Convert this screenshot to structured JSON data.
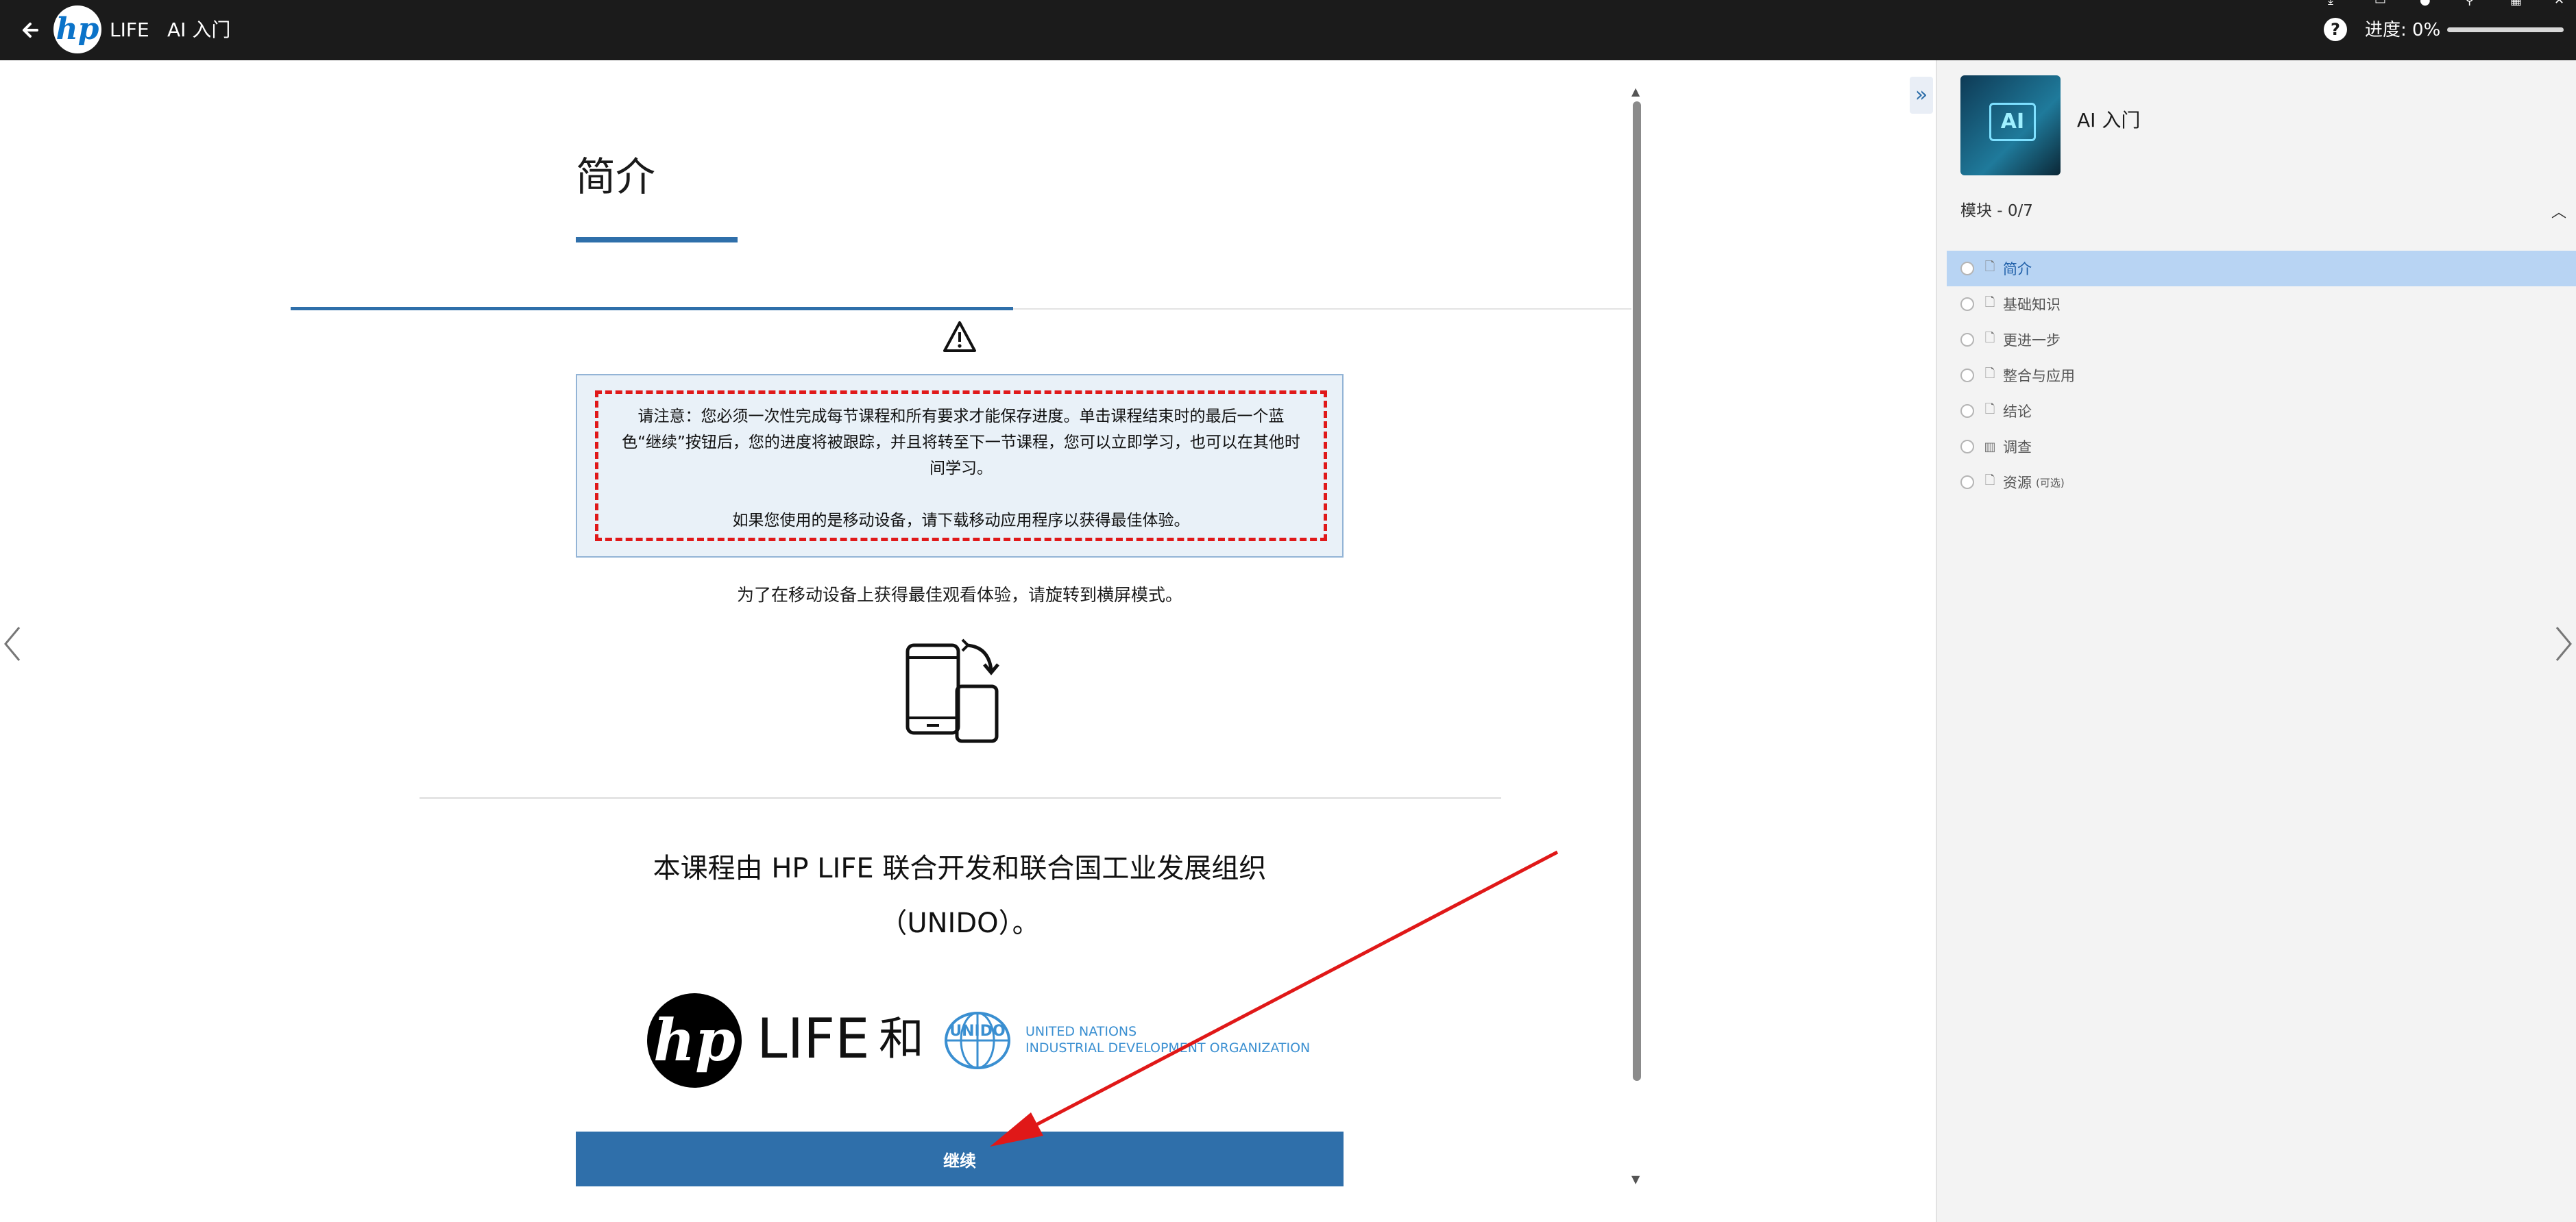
{
  "topbar": {
    "brand_label": "LIFE",
    "course_title": "AI 入门",
    "help_label": "?",
    "progress_label": "进度: 0%",
    "progress_percent": 0
  },
  "lesson": {
    "title": "简介",
    "notice_p1": "请注意：您必须一次性完成每节课程和所有要求才能保存进度。单击课程结束时的最后一个蓝色“继续”按钮后，您的进度将被跟踪，并且将转至下一节课程，您可以立即学习，也可以在其他时间学习。",
    "notice_p2": "如果您使用的是移动设备，请下载移动应用程序以获得最佳体验。",
    "rotate_text": "为了在移动设备上获得最佳观看体验，请旋转到横屏模式。",
    "credit_text": "本课程由 HP LIFE 联合开发和联合国工业发展组织（UNIDO）。",
    "logo_life": "LIFE",
    "logo_and": "和",
    "unido_line1": "UNITED NATIONS",
    "unido_line2": "INDUSTRIAL DEVELOPMENT ORGANIZATION",
    "continue_label": "继续"
  },
  "sidebar": {
    "course_title": "AI 入门",
    "thumb_label": "AI",
    "module_header": "模块 - 0/7",
    "modules": [
      {
        "label": "简介",
        "icon": "doc-icon",
        "active": true
      },
      {
        "label": "基础知识",
        "icon": "doc-icon"
      },
      {
        "label": "更进一步",
        "icon": "doc-icon"
      },
      {
        "label": "整合与应用",
        "icon": "doc-icon"
      },
      {
        "label": "结论",
        "icon": "doc-icon"
      },
      {
        "label": "调查",
        "icon": "chart-icon"
      },
      {
        "label": "资源",
        "icon": "doc-icon",
        "optional": "(可选)"
      }
    ]
  },
  "colors": {
    "topbar_bg": "#1b1b1b",
    "accent_blue": "#2f6faa",
    "notice_border_red": "#e0191a",
    "active_module_bg": "#b8d4f3",
    "unido_blue": "#3a8fd1"
  }
}
